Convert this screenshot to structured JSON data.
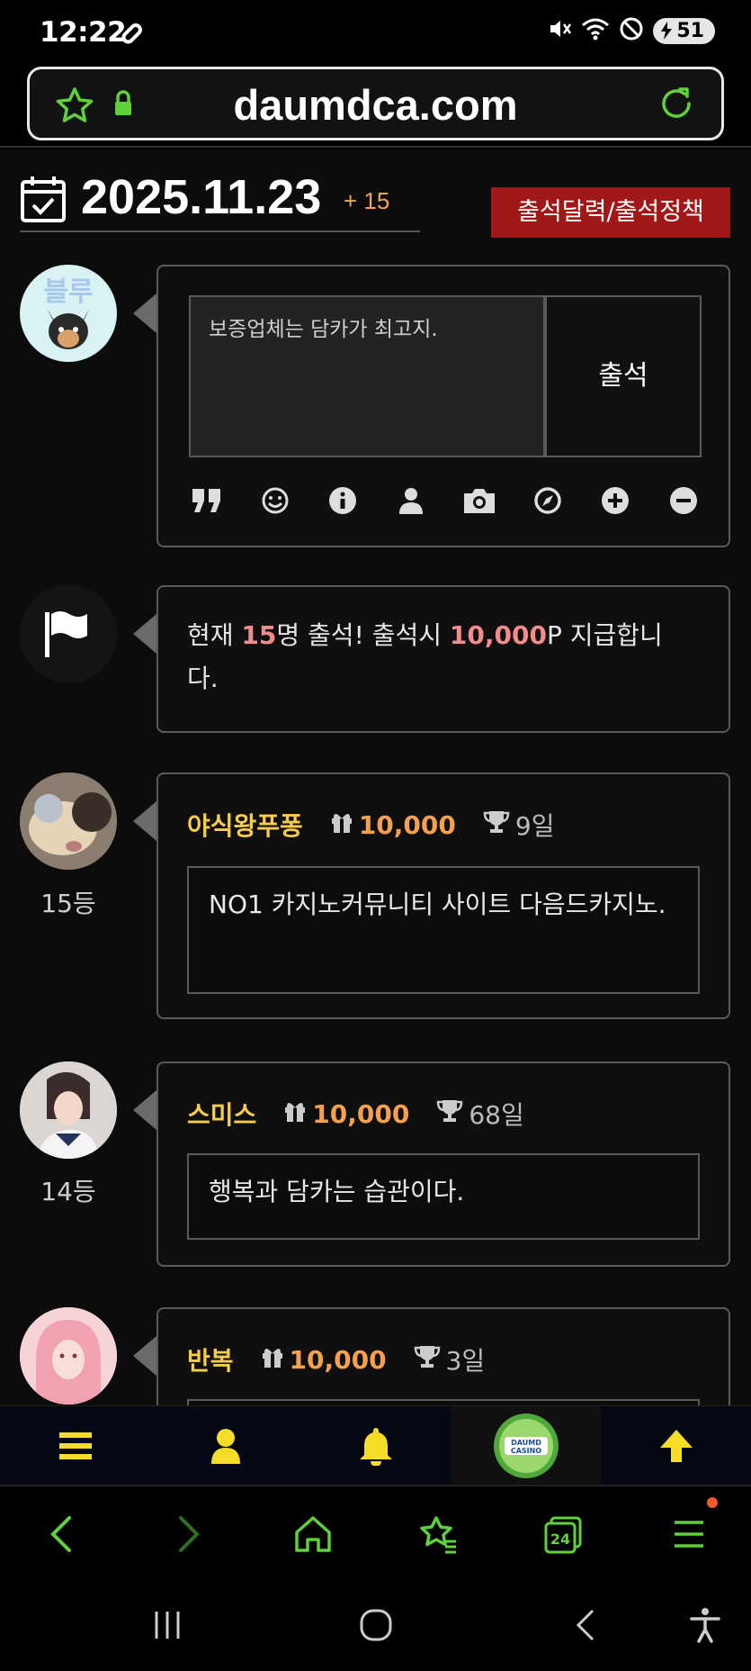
{
  "status_bar": {
    "time": "12:22",
    "battery": "51"
  },
  "browser": {
    "url": "daumdca.com"
  },
  "header": {
    "date": "2025.11.23",
    "count_badge": "+ 15",
    "policy_button": "출석달력/출석정책"
  },
  "compose": {
    "placeholder_text": "보증업체는 담카가 최고지.",
    "submit_label": "출석",
    "tools": [
      "quote-icon",
      "smile-icon",
      "info-icon",
      "user-icon",
      "camera-icon",
      "compass-icon",
      "plus-circle-icon",
      "minus-circle-icon"
    ]
  },
  "notice": {
    "prefix": "현재 ",
    "count": "15",
    "middle": "명 출석! 출석시 ",
    "points": "10,000",
    "suffix": "P 지급합니다."
  },
  "entries": [
    {
      "nickname": "야식왕푸퐁",
      "points": "10,000",
      "days": "9일",
      "message": "NO1 카지노커뮤니티 사이트 다음드카지노.",
      "rank": "15등"
    },
    {
      "nickname": "스미스",
      "points": "10,000",
      "days": "68일",
      "message": "행복과 담카는 습관이다.",
      "rank": "14등"
    },
    {
      "nickname": "반복",
      "points": "10,000",
      "days": "3일",
      "message": "",
      "rank": ""
    }
  ],
  "site_nav": {
    "logo_line1": "DAUMD",
    "logo_line2": "CASINO"
  },
  "colors": {
    "accent_green": "#5fd13a",
    "nav_yellow": "#f4dc28",
    "policy_red": "#a01818",
    "nick_yellow": "#f7cc4a",
    "points_orange": "#f5a04c",
    "highlight_pink": "#f48c8c"
  }
}
